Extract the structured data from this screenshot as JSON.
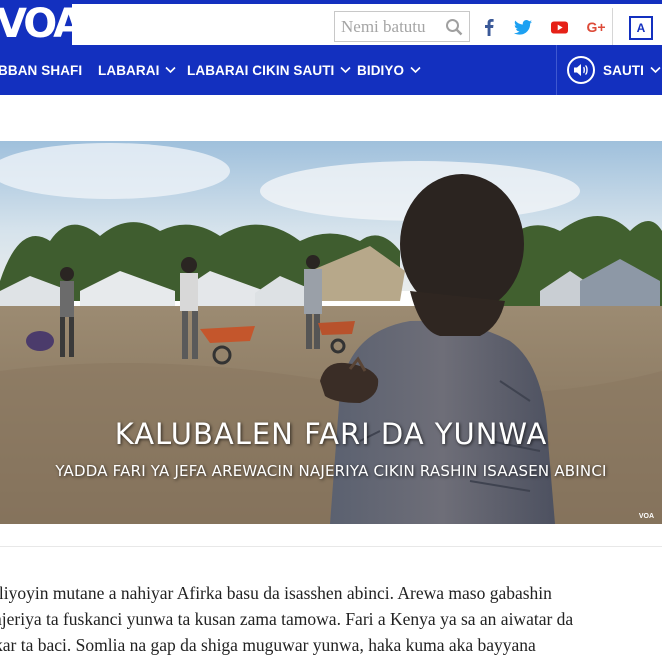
{
  "header": {
    "logo_text": "VOA",
    "search_placeholder": "Nemi batutu",
    "social_icons": [
      "facebook-icon",
      "twitter-icon",
      "youtube-icon",
      "googleplus-icon"
    ],
    "google_plus_label": "G+",
    "lang_icon_label": "A"
  },
  "nav": {
    "items": [
      {
        "label": "BBAN SHAFI",
        "has_dropdown": false
      },
      {
        "label": "LABARAI",
        "has_dropdown": true
      },
      {
        "label": "LABARAI CIKIN SAUTI",
        "has_dropdown": true
      },
      {
        "label": "BIDIYO",
        "has_dropdown": true
      }
    ],
    "audio_label": "SAUTI"
  },
  "hero": {
    "title": "KALUBALEN FARI DA YUNWA",
    "subtitle": "YADDA FARI YA JEFA AREWACIN NAJERIYA CIKIN RASHIN ISAASEN ABINCI",
    "watermark": "VOA"
  },
  "article": {
    "lines": [
      "iliyoyin mutane a nahiyar Afirka basu da isasshen abinci. Arewa maso gabashin",
      "ajeriya ta fuskanci yunwa ta kusan zama tamowa. Fari a Kenya ya sa an aiwatar da",
      "kar ta baci. Somlia na gap da shiga muguwar yunwa, haka kuma aka bayyana"
    ]
  },
  "colors": {
    "brand_blue": "#1330bf",
    "facebook": "#3b5998",
    "twitter": "#1da1f2",
    "youtube": "#e62117",
    "googleplus": "#dd4b39"
  }
}
